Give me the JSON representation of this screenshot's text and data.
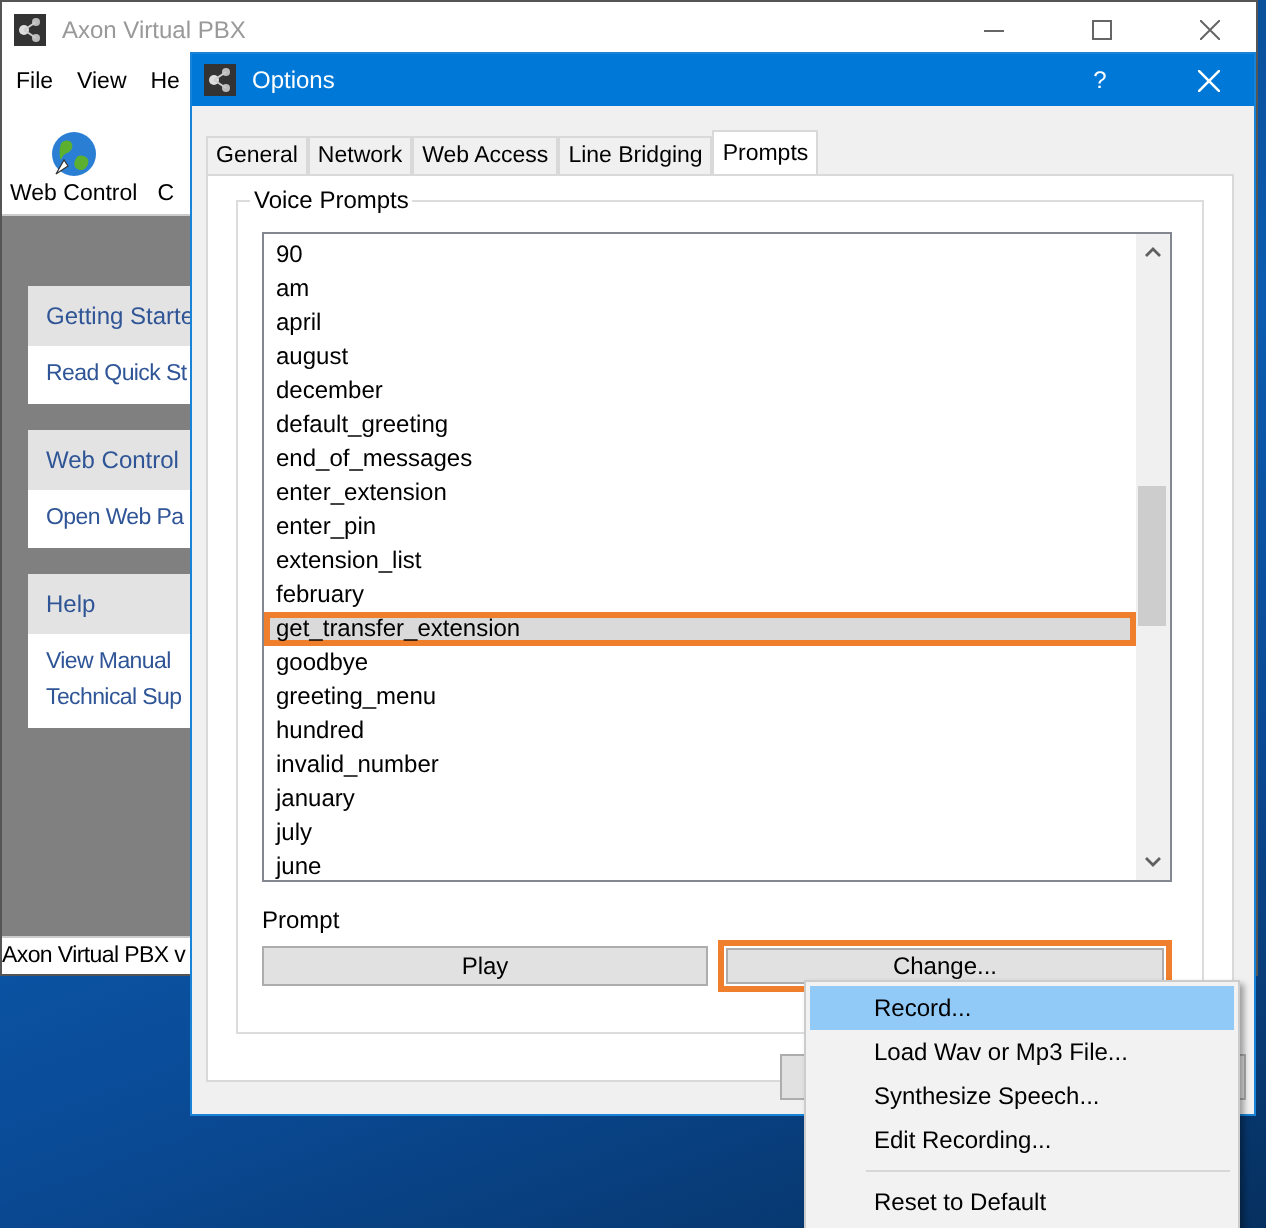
{
  "main_window": {
    "title": "Axon Virtual PBX",
    "menu": [
      "File",
      "View",
      "He"
    ],
    "toolbar": [
      {
        "label": "Web Control",
        "kind": "globe"
      },
      {
        "label": "C",
        "kind": "none"
      }
    ],
    "panels": [
      {
        "header": "Getting Starte",
        "links": [
          "Read Quick St"
        ]
      },
      {
        "header": "Web Control",
        "links": [
          "Open Web Pa"
        ]
      },
      {
        "header": "Help",
        "links": [
          "View Manual",
          "Technical Sup"
        ]
      }
    ],
    "status_bar": "Axon Virtual PBX v"
  },
  "dialog": {
    "title": "Options",
    "help": "?",
    "tabs": [
      {
        "label": "General",
        "selected": false
      },
      {
        "label": "Network",
        "selected": false
      },
      {
        "label": "Web Access",
        "selected": false
      },
      {
        "label": "Line Bridging",
        "selected": false
      },
      {
        "label": "Prompts",
        "selected": true
      }
    ],
    "group_title": "Voice Prompts",
    "prompts": [
      {
        "name": "90",
        "selected": false
      },
      {
        "name": "am",
        "selected": false
      },
      {
        "name": "april",
        "selected": false
      },
      {
        "name": "august",
        "selected": false
      },
      {
        "name": "december",
        "selected": false
      },
      {
        "name": "default_greeting",
        "selected": false
      },
      {
        "name": "end_of_messages",
        "selected": false
      },
      {
        "name": "enter_extension",
        "selected": false
      },
      {
        "name": "enter_pin",
        "selected": false
      },
      {
        "name": "extension_list",
        "selected": false
      },
      {
        "name": "february",
        "selected": false
      },
      {
        "name": "get_transfer_extension",
        "selected": true
      },
      {
        "name": "goodbye",
        "selected": false
      },
      {
        "name": "greeting_menu",
        "selected": false
      },
      {
        "name": "hundred",
        "selected": false
      },
      {
        "name": "invalid_number",
        "selected": false
      },
      {
        "name": "january",
        "selected": false
      },
      {
        "name": "july",
        "selected": false
      },
      {
        "name": "june",
        "selected": false
      }
    ],
    "prompt_label": "Prompt",
    "buttons": [
      {
        "label": "Play",
        "highlighted": false
      },
      {
        "label": "Change...",
        "highlighted": true
      }
    ]
  },
  "context_menu": [
    {
      "label": "Record...",
      "kind": "item",
      "selected": true
    },
    {
      "label": "Load Wav or Mp3 File...",
      "kind": "item",
      "selected": false
    },
    {
      "label": "Synthesize Speech...",
      "kind": "item",
      "selected": false
    },
    {
      "label": "Edit Recording...",
      "kind": "item",
      "selected": false
    },
    {
      "kind": "separator"
    },
    {
      "label": "Reset to Default",
      "kind": "item",
      "selected": false
    }
  ]
}
